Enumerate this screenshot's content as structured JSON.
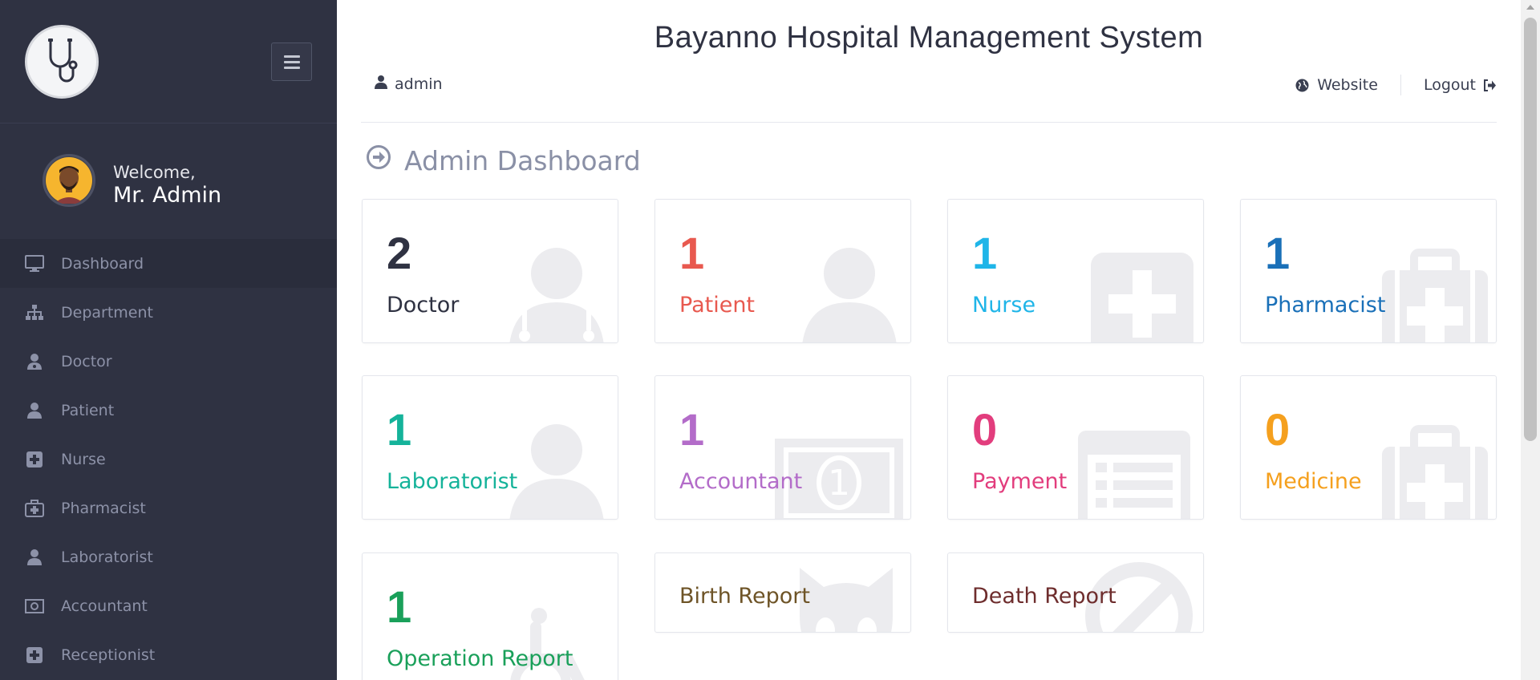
{
  "app": {
    "title": "Bayanno Hospital Management System"
  },
  "sidebar": {
    "welcome_small": "Welcome,",
    "welcome_name": "Mr. Admin",
    "items": [
      {
        "label": "Dashboard",
        "icon": "desktop-icon",
        "active": true
      },
      {
        "label": "Department",
        "icon": "sitemap-icon"
      },
      {
        "label": "Doctor",
        "icon": "user-md-icon"
      },
      {
        "label": "Patient",
        "icon": "user-icon"
      },
      {
        "label": "Nurse",
        "icon": "plus-square-icon"
      },
      {
        "label": "Pharmacist",
        "icon": "medkit-icon"
      },
      {
        "label": "Laboratorist",
        "icon": "user-icon"
      },
      {
        "label": "Accountant",
        "icon": "money-icon"
      },
      {
        "label": "Receptionist",
        "icon": "plus-square-icon"
      }
    ]
  },
  "topbar": {
    "user": "admin",
    "website": "Website",
    "logout": "Logout"
  },
  "page": {
    "heading": "Admin Dashboard"
  },
  "cards": [
    {
      "value": "2",
      "label": "Doctor",
      "color": "#2f3242",
      "icon": "user-md-icon"
    },
    {
      "value": "1",
      "label": "Patient",
      "color": "#e8594f",
      "icon": "user-icon"
    },
    {
      "value": "1",
      "label": "Nurse",
      "color": "#1fb5e8",
      "icon": "plus-square-icon"
    },
    {
      "value": "1",
      "label": "Pharmacist",
      "color": "#1a70b8",
      "icon": "medkit-icon"
    },
    {
      "value": "1",
      "label": "Laboratorist",
      "color": "#15b39a",
      "icon": "user-icon"
    },
    {
      "value": "1",
      "label": "Accountant",
      "color": "#b36cc9",
      "icon": "money-icon"
    },
    {
      "value": "0",
      "label": "Payment",
      "color": "#e23d7d",
      "icon": "list-alt-icon"
    },
    {
      "value": "0",
      "label": "Medicine",
      "color": "#f5a01e",
      "icon": "medkit-icon"
    },
    {
      "value": "1",
      "label": "Operation Report",
      "color": "#1aa05a",
      "icon": "wheelchair-icon"
    },
    {
      "value": "",
      "label": "Birth Report",
      "color": "#6e5427",
      "icon": "github-alt-icon"
    },
    {
      "value": "",
      "label": "Death Report",
      "color": "#6e2d2d",
      "icon": "ban-icon"
    }
  ],
  "colors": {
    "sidebar_bg": "#2f3242",
    "sidebar_text": "#8d92a8",
    "heading": "#8a90a6"
  }
}
